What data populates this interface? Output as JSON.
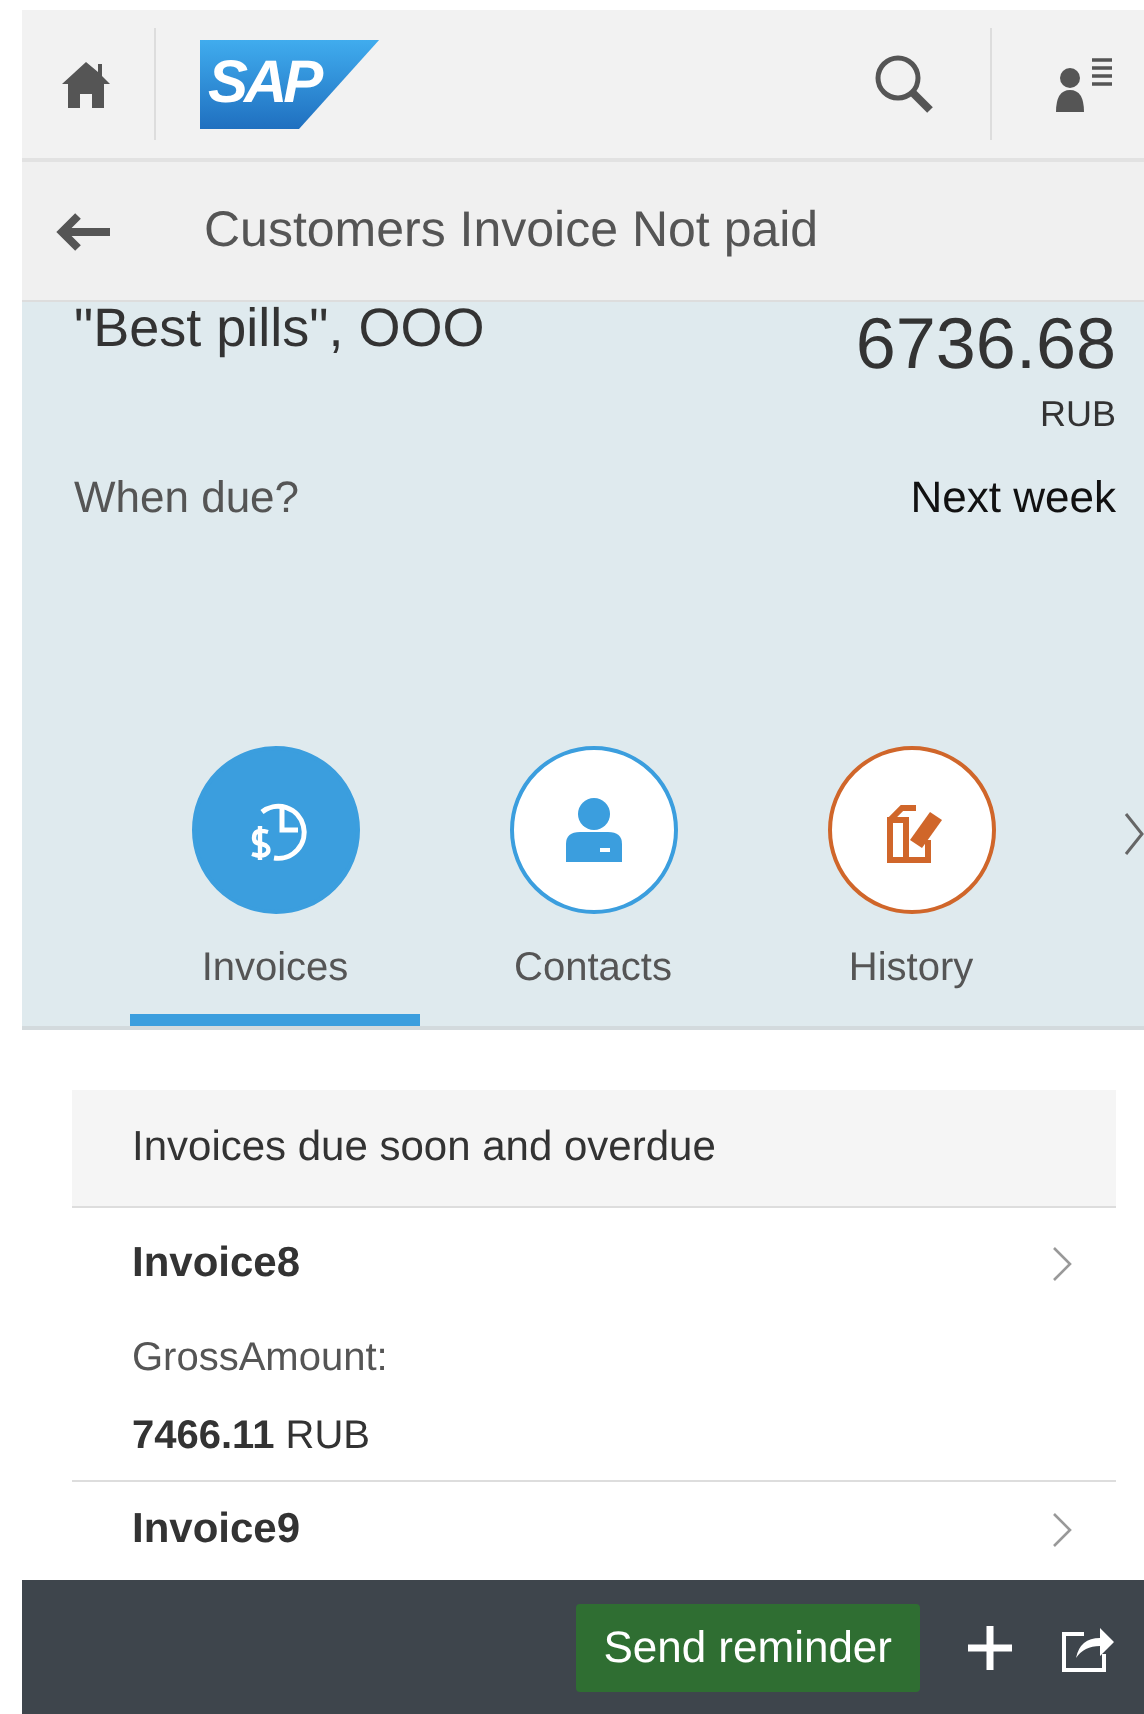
{
  "shell": {
    "logo": "SAP"
  },
  "page": {
    "title": "Customers Invoice Not paid"
  },
  "header": {
    "customer": "\"Best pills\", OOO",
    "amount": "6736.68",
    "currency": "RUB",
    "due_label": "When due?",
    "due_value": "Next week"
  },
  "tabs": [
    {
      "label": "Invoices",
      "selected": true,
      "color": "#3b9ede",
      "kind": "invoices"
    },
    {
      "label": "Contacts",
      "selected": false,
      "color": "#3b9ede",
      "kind": "contacts"
    },
    {
      "label": "History",
      "selected": false,
      "color": "#d0662a",
      "kind": "history"
    }
  ],
  "list": {
    "group_title": "Invoices due soon and overdue",
    "items": [
      {
        "title": "Invoice8",
        "attribute_label": "GrossAmount:",
        "amount": "7466.11",
        "currency": "RUB"
      },
      {
        "title": "Invoice9"
      }
    ]
  },
  "footer": {
    "buttons": [
      {
        "label": "Send reminder"
      }
    ]
  }
}
